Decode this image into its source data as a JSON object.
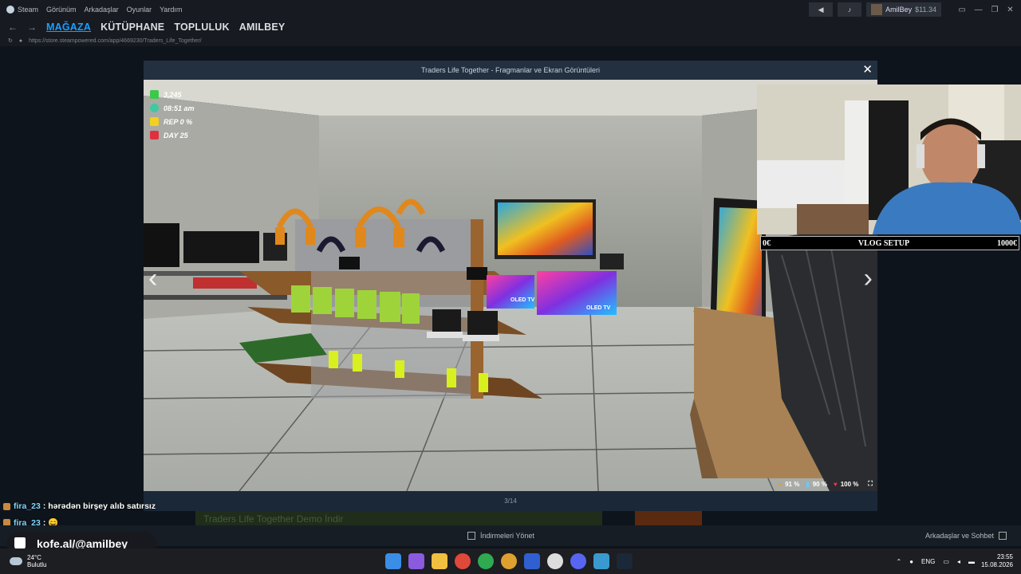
{
  "menubar": {
    "items": [
      "Steam",
      "Görünüm",
      "Arkadaşlar",
      "Oyunlar",
      "Yardım"
    ]
  },
  "account": {
    "name": "AmilBey",
    "balance": "$11.34"
  },
  "nav": {
    "tabs": [
      "MAĞAZA",
      "KÜTÜPHANE",
      "TOPLULUK",
      "AMILBEY"
    ],
    "active": "MAĞAZA"
  },
  "url": "https://store.steampowered.com/app/4669230/Traders_Life_Together/",
  "modal": {
    "title": "Traders Life Together - Fragmanlar ve Ekran Görüntüleri",
    "counter": "3/14"
  },
  "hud": {
    "money": "3,245",
    "time": "08:51 am",
    "rep": "REP 0 %",
    "day": "DAY 25",
    "food": "91 %",
    "water": "90 %",
    "health": "100 %"
  },
  "scene": {
    "tv_label_1": "OLED TV",
    "tv_label_2": "OLED TV"
  },
  "stream": {
    "vlog_left": "0€",
    "vlog_title": "VLOG SETUP",
    "vlog_right": "1000€",
    "kofe": "kofe.al/@amilbey"
  },
  "chat": [
    {
      "user": "fira_23",
      "message": ": hərədən birşey alıb satırsız"
    },
    {
      "user": "fira_23",
      "message": ": 😄"
    }
  ],
  "store_bg": {
    "demo_button": "Traders Life Together Demo İndir"
  },
  "bottom": {
    "downloads": "İndirmeleri Yönet",
    "friends": "Arkadaşlar ve Sohbet"
  },
  "taskbar": {
    "temp": "24°C",
    "weather": "Bulutlu",
    "lang": "ENG",
    "time": "23:55",
    "date": "15.08.2026"
  },
  "colors": {
    "accent": "#1a9fff",
    "steam_bg": "#171a21",
    "modal_bg": "#1b2838"
  }
}
